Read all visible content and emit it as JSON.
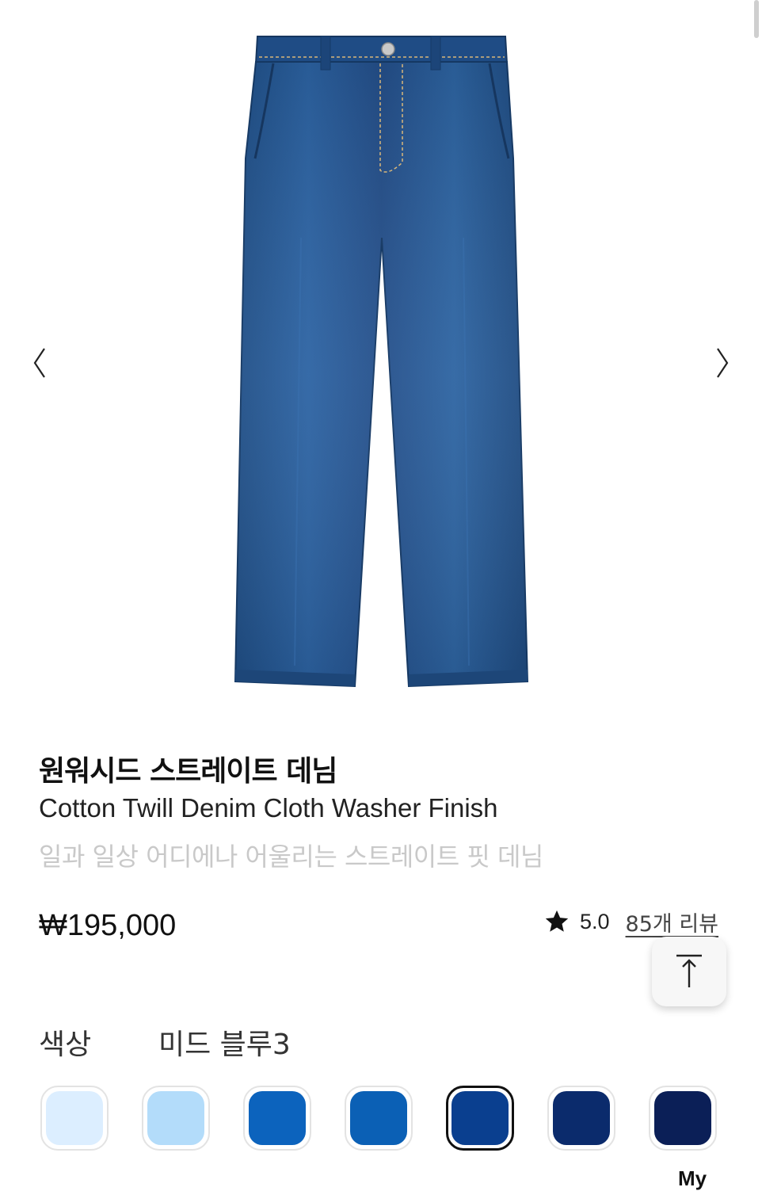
{
  "gallery": {
    "image_alt": "jeans-product-photo",
    "prev_icon": "chevron-left-icon",
    "next_icon": "chevron-right-icon"
  },
  "product": {
    "title": "원워시드 스트레이트 데님",
    "subtitle": "Cotton Twill Denim Cloth Washer Finish",
    "tagline": "일과 일상 어디에나 어울리는 스트레이트 핏 데님",
    "price": "₩195,000",
    "rating": "5.0",
    "reviews": "85개 리뷰"
  },
  "color": {
    "label": "색상",
    "selected_name": "미드 블루3",
    "swatches": [
      {
        "color": "#dceeff"
      },
      {
        "color": "#b3dcfa"
      },
      {
        "color": "#0c63bd"
      },
      {
        "color": "#0b60b5"
      },
      {
        "color": "#0a3f8f",
        "selected": true
      },
      {
        "color": "#0b2b6c"
      },
      {
        "color": "#0b1f57"
      }
    ],
    "partial_caption": "My"
  },
  "icons": {
    "rating": "star-icon",
    "scroll_top": "arrow-up-to-top-icon"
  }
}
